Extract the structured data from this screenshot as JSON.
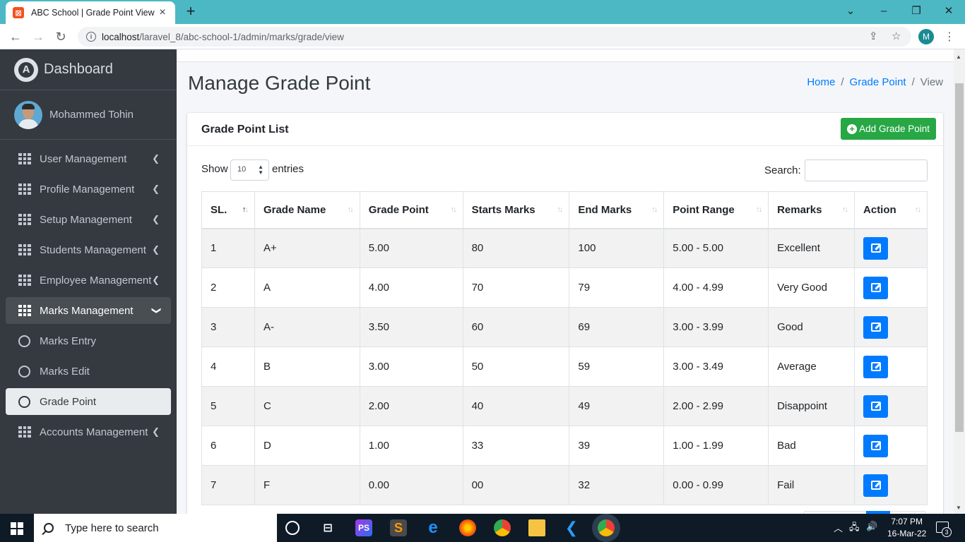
{
  "browser": {
    "tab_title": "ABC School | Grade Point View",
    "url_host": "localhost",
    "url_path": "/laravel_8/abc-school-1/admin/marks/grade/view",
    "profile_initial": "M"
  },
  "sidebar": {
    "brand": "Dashboard",
    "user_name": "Mohammed Tohin",
    "items": [
      {
        "label": "User Management"
      },
      {
        "label": "Profile Management"
      },
      {
        "label": "Setup Management"
      },
      {
        "label": "Students Management"
      },
      {
        "label": "Employee Management"
      },
      {
        "label": "Marks Management"
      },
      {
        "label": "Marks Entry"
      },
      {
        "label": "Marks Edit"
      },
      {
        "label": "Grade Point"
      },
      {
        "label": "Accounts Management"
      }
    ]
  },
  "page": {
    "title": "Manage Grade Point",
    "breadcrumb": {
      "home": "Home",
      "section": "Grade Point",
      "current": "View"
    }
  },
  "card": {
    "title": "Grade Point List",
    "add_button": "Add Grade Point",
    "show_label": "Show",
    "entries_value": "10",
    "entries_label": "entries",
    "search_label": "Search:"
  },
  "table": {
    "headers": [
      "SL.",
      "Grade Name",
      "Grade Point",
      "Starts Marks",
      "End Marks",
      "Point Range",
      "Remarks",
      "Action"
    ],
    "rows": [
      [
        "1",
        "A+",
        "5.00",
        "80",
        "100",
        "5.00 - 5.00",
        "Excellent"
      ],
      [
        "2",
        "A",
        "4.00",
        "70",
        "79",
        "4.00 - 4.99",
        "Very Good"
      ],
      [
        "3",
        "A-",
        "3.50",
        "60",
        "69",
        "3.00 - 3.99",
        "Good"
      ],
      [
        "4",
        "B",
        "3.00",
        "50",
        "59",
        "3.00 - 3.49",
        "Average"
      ],
      [
        "5",
        "C",
        "2.00",
        "40",
        "49",
        "2.00 - 2.99",
        "Disappoint"
      ],
      [
        "6",
        "D",
        "1.00",
        "33",
        "39",
        "1.00 - 1.99",
        "Bad"
      ],
      [
        "7",
        "F",
        "0.00",
        "00",
        "32",
        "0.00 - 0.99",
        "Fail"
      ]
    ]
  },
  "taskbar": {
    "search_placeholder": "Type here to search",
    "time": "7:07 PM",
    "date": "16-Mar-22",
    "notification_count": "3"
  }
}
